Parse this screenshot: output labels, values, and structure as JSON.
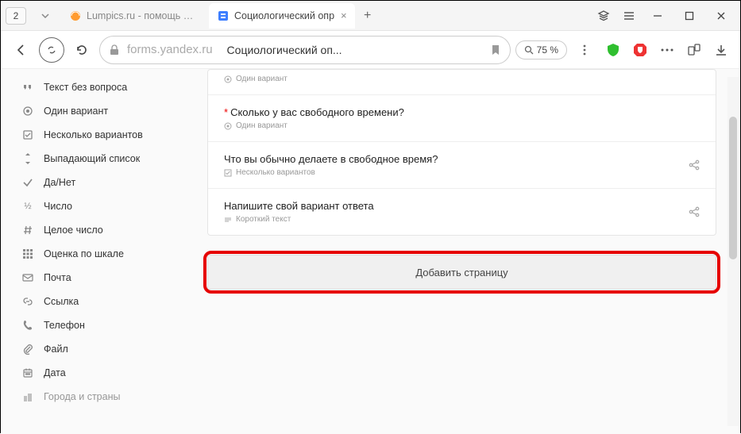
{
  "browser": {
    "tab_count": "2",
    "tabs": [
      {
        "title": "Lumpics.ru - помощь с ко"
      },
      {
        "title": "Социологический опр"
      }
    ],
    "url_domain": "forms.yandex.ru",
    "url_title": "Социологический оп...",
    "zoom": "75 %"
  },
  "sidebar": {
    "items": [
      {
        "label": "Текст без вопроса"
      },
      {
        "label": "Один вариант"
      },
      {
        "label": "Несколько вариантов"
      },
      {
        "label": "Выпадающий список"
      },
      {
        "label": "Да/Нет"
      },
      {
        "label": "Число"
      },
      {
        "label": "Целое число"
      },
      {
        "label": "Оценка по шкале"
      },
      {
        "label": "Почта"
      },
      {
        "label": "Ссылка"
      },
      {
        "label": "Телефон"
      },
      {
        "label": "Файл"
      },
      {
        "label": "Дата"
      },
      {
        "label": "Города и страны"
      }
    ]
  },
  "questions": {
    "q0_meta": "Один вариант",
    "q1_title": "Сколько у вас свободного времени?",
    "q1_meta": "Один вариант",
    "q2_title": "Что вы обычно делаете в свободное время?",
    "q2_meta": "Несколько вариантов",
    "q3_title": "Напишите свой вариант ответа",
    "q3_meta": "Короткий текст"
  },
  "buttons": {
    "add_page": "Добавить страницу"
  }
}
